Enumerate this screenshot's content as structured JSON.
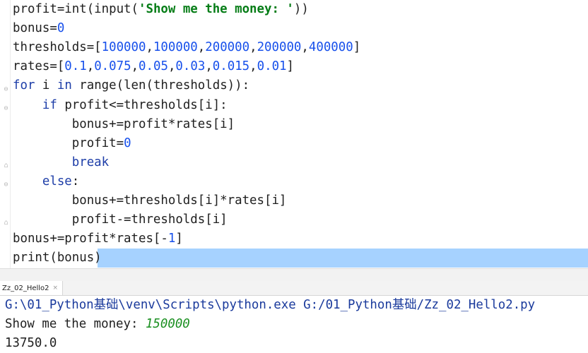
{
  "editor": {
    "lines": [
      {
        "segments": [
          {
            "t": "profit=int(input(",
            "c": ""
          },
          {
            "t": "'Show me the money: '",
            "c": "str"
          },
          {
            "t": "))",
            "c": ""
          }
        ]
      },
      {
        "segments": [
          {
            "t": "bonus=",
            "c": ""
          },
          {
            "t": "0",
            "c": "num"
          }
        ]
      },
      {
        "segments": [
          {
            "t": "thresholds=[",
            "c": ""
          },
          {
            "t": "100000",
            "c": "num"
          },
          {
            "t": ",",
            "c": ""
          },
          {
            "t": "100000",
            "c": "num"
          },
          {
            "t": ",",
            "c": ""
          },
          {
            "t": "200000",
            "c": "num"
          },
          {
            "t": ",",
            "c": ""
          },
          {
            "t": "200000",
            "c": "num"
          },
          {
            "t": ",",
            "c": ""
          },
          {
            "t": "400000",
            "c": "num"
          },
          {
            "t": "]",
            "c": ""
          }
        ]
      },
      {
        "segments": [
          {
            "t": "rates=[",
            "c": ""
          },
          {
            "t": "0.1",
            "c": "num"
          },
          {
            "t": ",",
            "c": ""
          },
          {
            "t": "0.075",
            "c": "num"
          },
          {
            "t": ",",
            "c": ""
          },
          {
            "t": "0.05",
            "c": "num"
          },
          {
            "t": ",",
            "c": ""
          },
          {
            "t": "0.03",
            "c": "num"
          },
          {
            "t": ",",
            "c": ""
          },
          {
            "t": "0.015",
            "c": "num"
          },
          {
            "t": ",",
            "c": ""
          },
          {
            "t": "0.01",
            "c": "num"
          },
          {
            "t": "]",
            "c": ""
          }
        ]
      },
      {
        "segments": [
          {
            "t": "for",
            "c": "kw"
          },
          {
            "t": " i ",
            "c": ""
          },
          {
            "t": "in",
            "c": "kw"
          },
          {
            "t": " range(len(thresholds)):",
            "c": ""
          }
        ]
      },
      {
        "segments": [
          {
            "t": "    ",
            "c": ""
          },
          {
            "t": "if",
            "c": "kw"
          },
          {
            "t": " profit<=thresholds[i]:",
            "c": ""
          }
        ]
      },
      {
        "segments": [
          {
            "t": "        bonus+=profit*rates[i]",
            "c": ""
          }
        ]
      },
      {
        "segments": [
          {
            "t": "        profit=",
            "c": ""
          },
          {
            "t": "0",
            "c": "num"
          }
        ]
      },
      {
        "segments": [
          {
            "t": "        ",
            "c": ""
          },
          {
            "t": "break",
            "c": "kw"
          }
        ]
      },
      {
        "segments": [
          {
            "t": "    ",
            "c": ""
          },
          {
            "t": "else",
            "c": "kw"
          },
          {
            "t": ":",
            "c": ""
          }
        ]
      },
      {
        "segments": [
          {
            "t": "        bonus+=thresholds[i]*rates[i]",
            "c": ""
          }
        ]
      },
      {
        "segments": [
          {
            "t": "        profit-=thresholds[i]",
            "c": ""
          }
        ]
      },
      {
        "segments": [
          {
            "t": "bonus+=profit*rates[-",
            "c": ""
          },
          {
            "t": "1",
            "c": "num"
          },
          {
            "t": "]",
            "c": ""
          }
        ]
      },
      {
        "segments": [
          {
            "t": "print(bonus)",
            "c": ""
          }
        ]
      }
    ]
  },
  "run_tab": {
    "label": "Zz_02_Hello2",
    "close_glyph": "×"
  },
  "console": {
    "command": "G:\\01_Python基础\\venv\\Scripts\\python.exe G:/01_Python基础/Zz_02_Hello2.py",
    "prompt": "Show me the money: ",
    "user_input": "150000",
    "output": "13750.0"
  },
  "colors": {
    "keyword": "#1e3ea8",
    "number": "#1750eb",
    "string": "#067d17",
    "selection": "#a6d2ff",
    "console_input": "#1a8f20"
  }
}
